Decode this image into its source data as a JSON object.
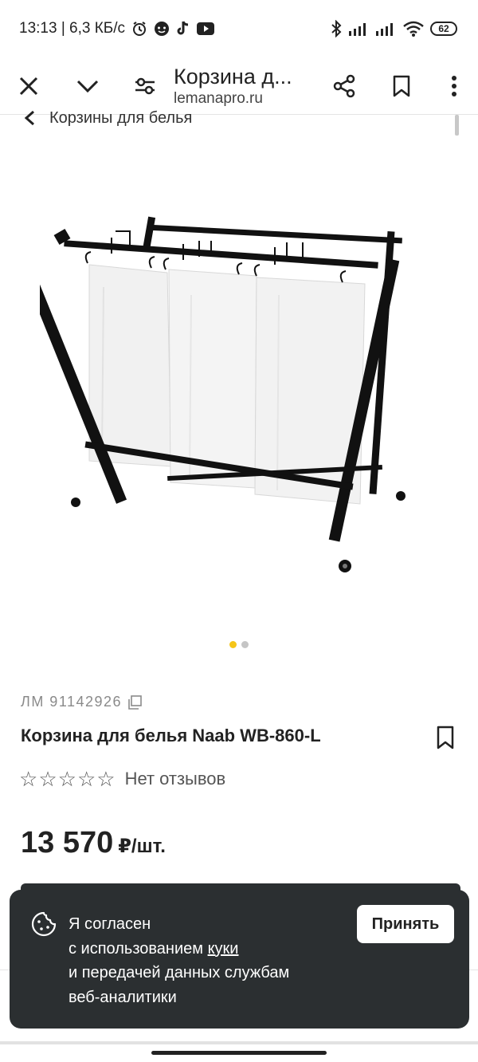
{
  "status_bar": {
    "time_speed": "13:13 | 6,3 КБ/с",
    "battery": "62",
    "icons": [
      "alarm-icon",
      "message-icon",
      "tiktok-icon",
      "youtube-icon",
      "bluetooth-icon",
      "signal-icon",
      "signal-icon",
      "wifi-icon",
      "battery-icon"
    ]
  },
  "browser": {
    "title": "Корзина д...",
    "url": "lemanapro.ru",
    "icons": [
      "close-icon",
      "chevron-down-icon",
      "filter-icon",
      "share-icon",
      "bookmark-icon",
      "more-vert-icon"
    ]
  },
  "breadcrumb": {
    "label": "Корзины для белья"
  },
  "gallery": {
    "image_alt": "laundry-basket-image",
    "dot_count": 2,
    "active_index": 0,
    "colors": {
      "active": "#f5c518",
      "inactive": "#c5c5c5"
    }
  },
  "product": {
    "sku": "ЛМ 91142926",
    "title": "Корзина для белья Naab WB-860-L",
    "rating_stars": 0,
    "rating_max": 5,
    "reviews": "Нет отзывов",
    "price": "13 570",
    "price_unit": "₽/шт."
  },
  "cookie_banner": {
    "line1": "Я согласен",
    "line2_prefix": "с использованием",
    "line2_link": "куки",
    "line3": "и передачей данных службам",
    "line4": "веб-аналитики",
    "accept_label": "Принять",
    "background": "#2b2f31"
  }
}
